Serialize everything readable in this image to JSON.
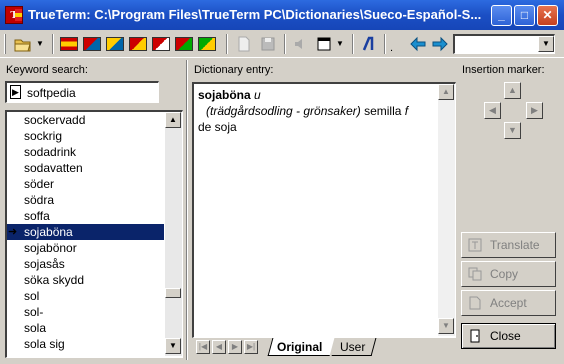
{
  "window": {
    "title": "TrueTerm: C:\\Program Files\\TrueTerm PC\\Dictionaries\\Sueco-Español-S..."
  },
  "titlebar_buttons": {
    "minimize": "_",
    "maximize": "□",
    "close": "✕"
  },
  "keyword": {
    "label": "Keyword search:",
    "value": "softpedia"
  },
  "word_list": [
    "sockervadd",
    "sockrig",
    "sodadrink",
    "sodavatten",
    "söder",
    "södra",
    "soffa",
    "sojaböna",
    "sojabönor",
    "sojasås",
    "söka skydd",
    "sol",
    "sol-",
    "sola",
    "sola sig"
  ],
  "selected_word": "sojaböna",
  "entry": {
    "label": "Dictionary entry:",
    "headword": "sojaböna",
    "gender": "u",
    "context": "(trädgårdsodling - grönsaker)",
    "translation": "semilla",
    "trans_gender": "f",
    "continuation": "de soja"
  },
  "insertion_marker": {
    "label": "Insertion marker:"
  },
  "buttons": {
    "translate": "Translate",
    "copy": "Copy",
    "accept": "Accept",
    "close": "Close"
  },
  "tabs": {
    "original": "Original",
    "user": "User"
  },
  "toolbar": {
    "icons": [
      "open-folder-icon",
      "dropdown-icon",
      "flag-es-icon",
      "flag-es-se-icon",
      "flag-se-icon",
      "flag-dk-icon",
      "flag-no-icon",
      "flag-pt-icon",
      "new-doc-icon",
      "save-icon",
      "speaker-icon",
      "view-icon",
      "font-icon",
      "back-arrow-icon",
      "forward-arrow-icon"
    ],
    "history_value": ""
  },
  "colors": {
    "selection": "#0a246a",
    "titlebar": "#1b4fc4"
  }
}
